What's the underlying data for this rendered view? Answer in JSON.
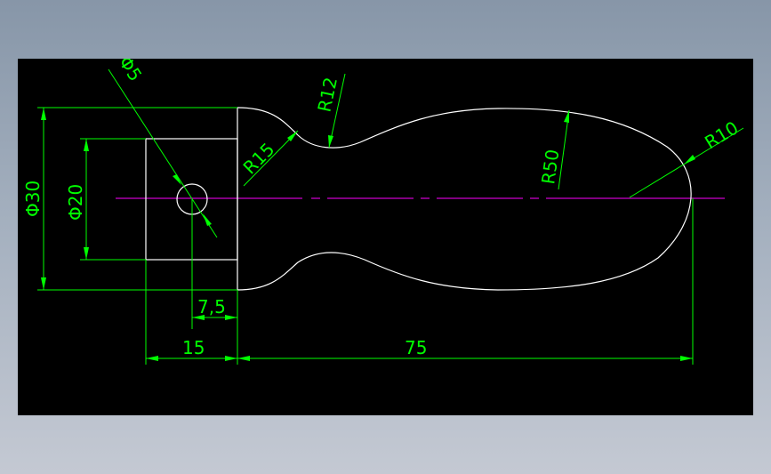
{
  "drawing": {
    "colors": {
      "background": "#000000",
      "geometry": "#ffffff",
      "dimension": "#00ff00",
      "centerline": "#ff00ff"
    },
    "dimensions": {
      "dia_hole": "Φ5",
      "dia_30": "Φ30",
      "dia_20": "Φ20",
      "r15": "R15",
      "r12": "R12",
      "r50": "R50",
      "r10": "R10",
      "len_7_5": "7,5",
      "len_15": "15",
      "len_75": "75"
    }
  }
}
